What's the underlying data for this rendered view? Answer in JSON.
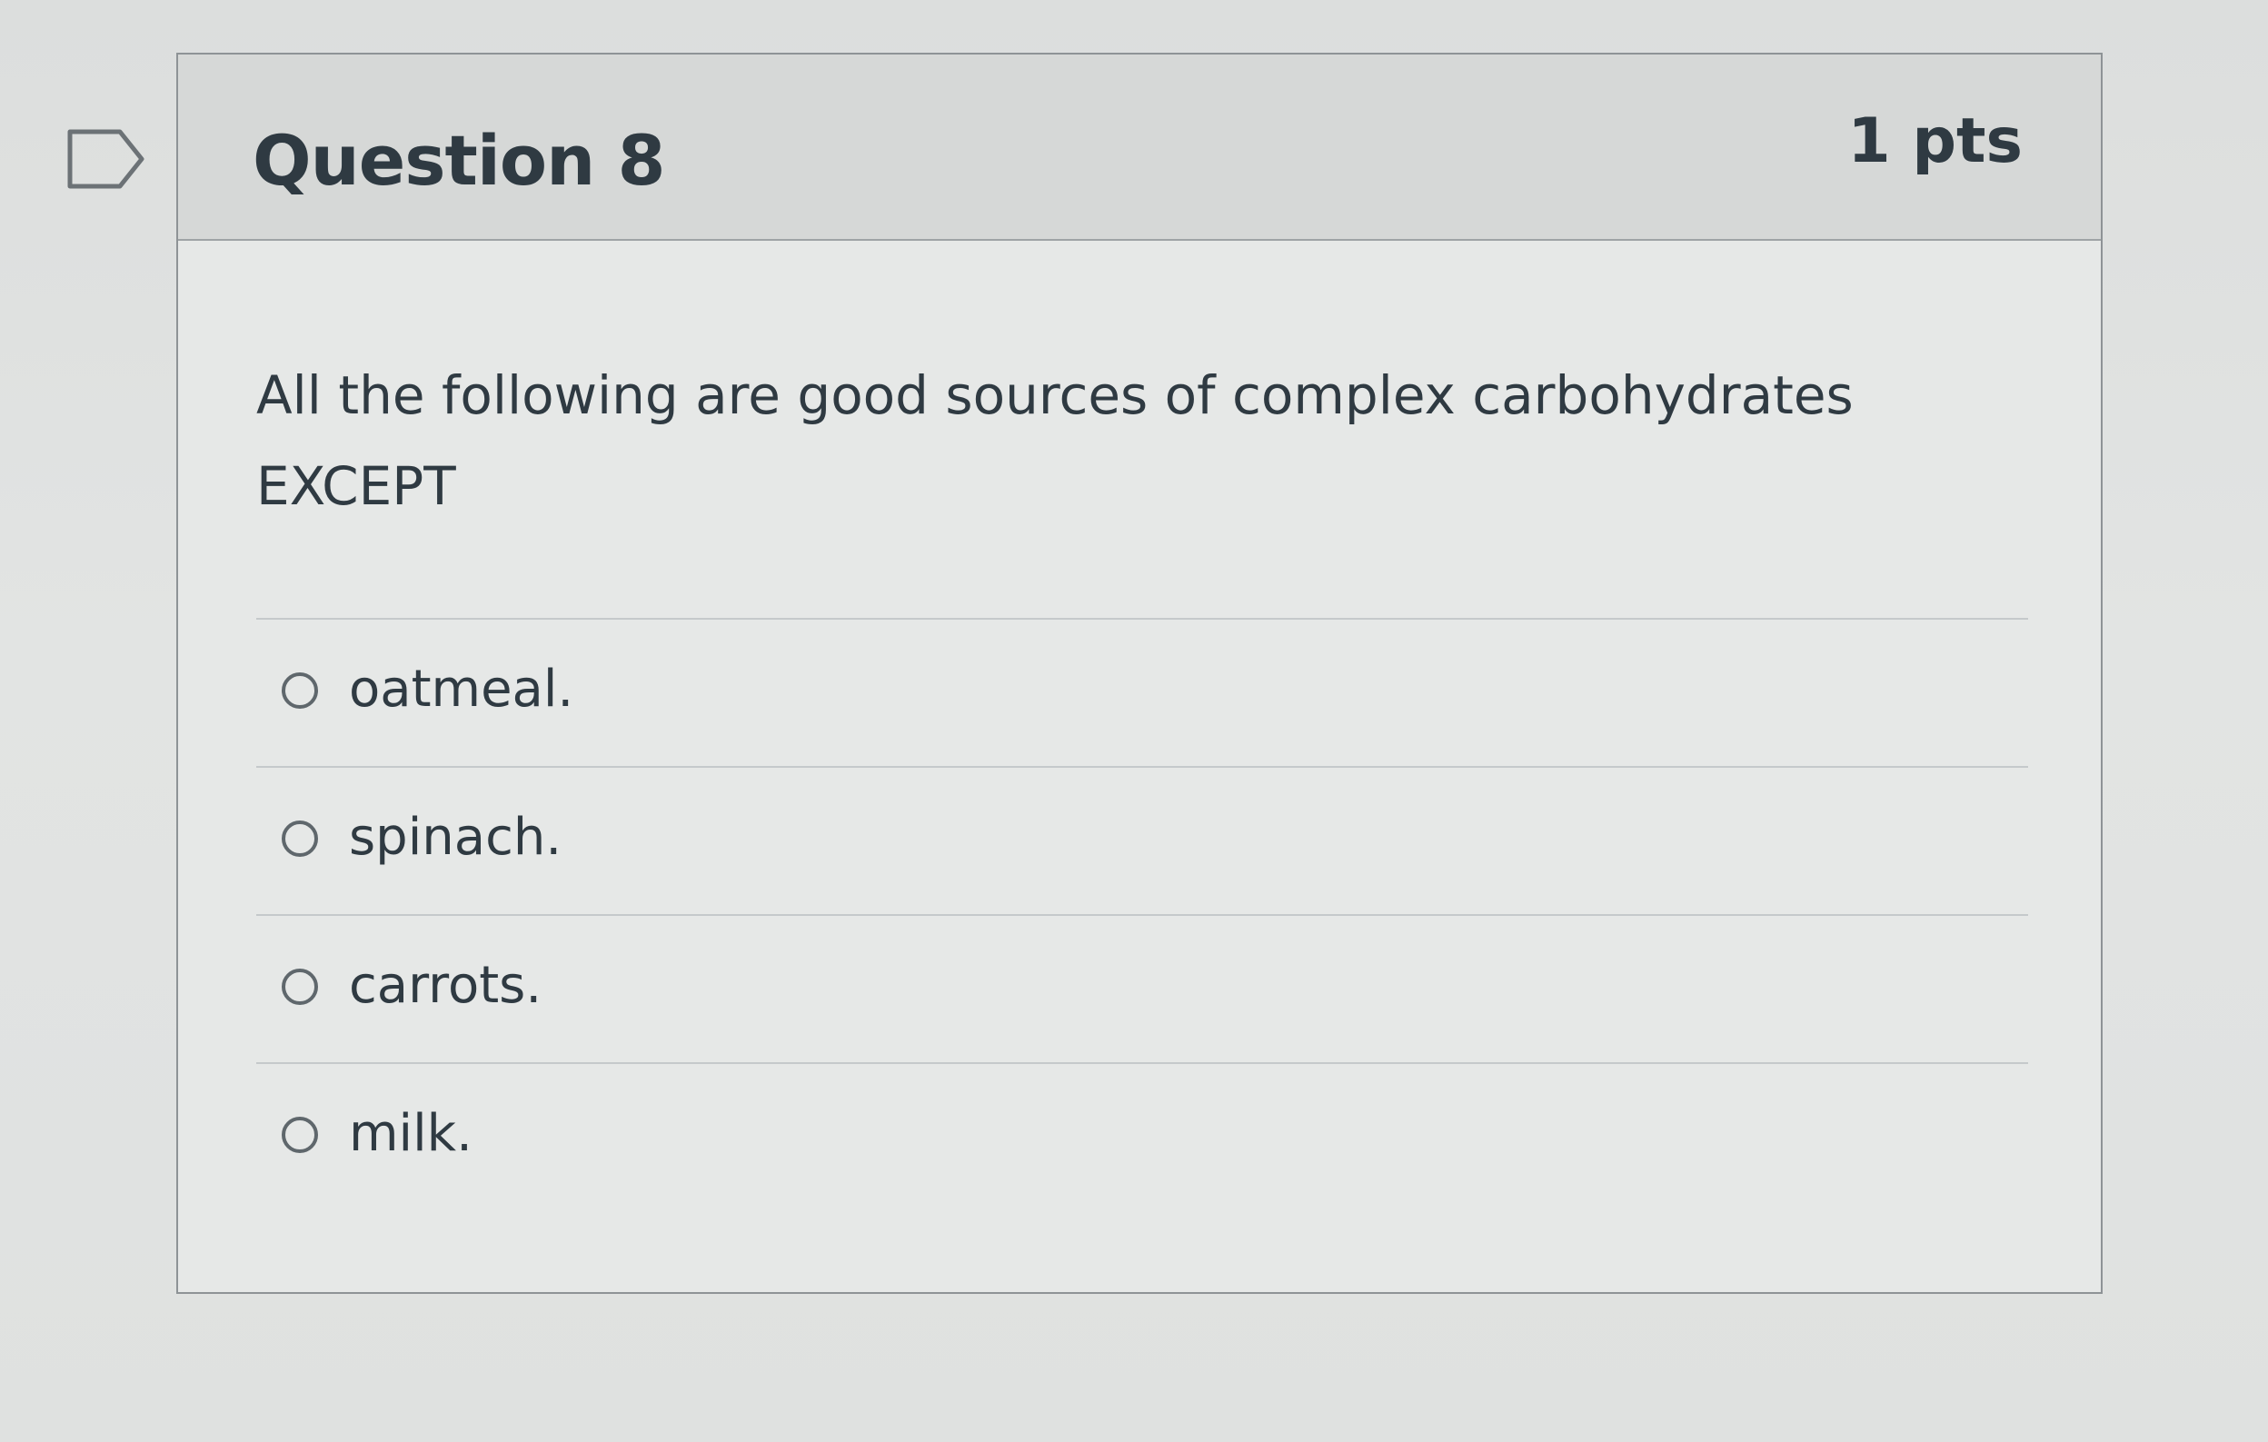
{
  "question": {
    "title": "Question 8",
    "points": "1 pts",
    "text_line1": "All the following are good sources of complex carbohydrates",
    "text_line2": "EXCEPT",
    "flag_icon": "flag-outline-icon",
    "answers": [
      {
        "label": "oatmeal.",
        "selected": false
      },
      {
        "label": "spinach.",
        "selected": false
      },
      {
        "label": "carrots.",
        "selected": false
      },
      {
        "label": "milk.",
        "selected": false
      }
    ]
  }
}
